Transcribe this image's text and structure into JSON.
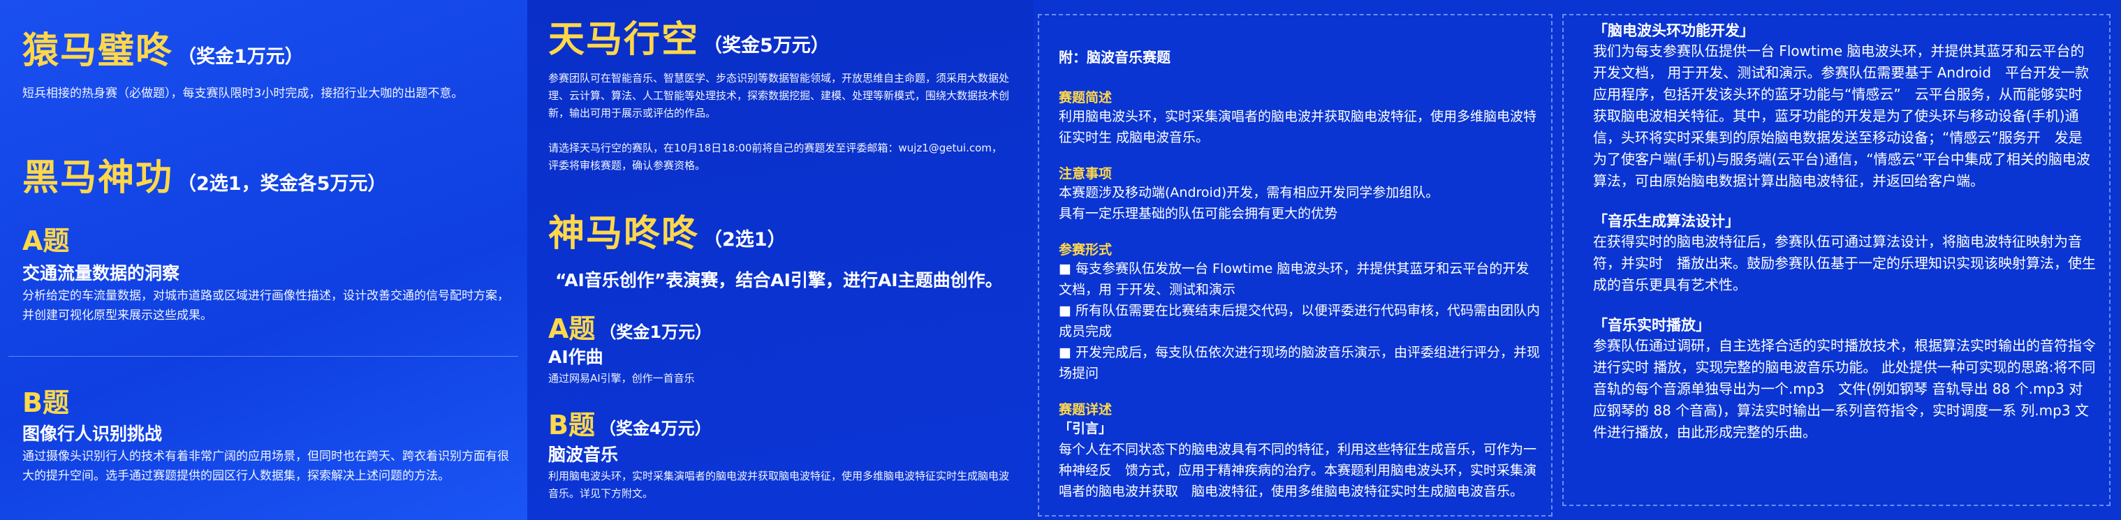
{
  "panel1": {
    "yuanma": {
      "title": "猿马璧咚",
      "sub": "（奖金1万元）",
      "desc": "短兵相接的热身赛（必做题），每支赛队限时3小时完成，接招行业大咖的出题不意。"
    },
    "heima": {
      "title": "黑马神功",
      "sub": "（2选1，奖金各5万元）"
    },
    "a": {
      "title": "A题",
      "name": "交通流量数据的洞察",
      "desc": "分析给定的车流量数据，对城市道路或区域进行画像性描述，设计改善交通的信号配时方案，并创建可视化原型来展示这些成果。"
    },
    "b": {
      "title": "B题",
      "name": "图像行人识别挑战",
      "desc": "通过摄像头识别行人的技术有着非常广阔的应用场景，但同时也在跨天、跨衣着识别方面有很大的提升空间。选手通过赛题提供的园区行人数据集，探索解决上述问题的方法。"
    }
  },
  "panel2": {
    "tianma": {
      "title": "天马行空",
      "sub": "（奖金5万元）",
      "desc": "参赛团队可在智能音乐、智慧医学、步态识别等数据智能领域，开放思维自主命题，须采用大数据处理、云计算、算法、人工智能等处理技术，探索数据挖掘、建模、处理等新模式，围绕大数据技术创新，输出可用于展示或评估的作品。",
      "note": "请选择天马行空的赛队，在10月18日18:00前将自己的赛题发至评委邮箱：wujz1@getui.com，评委将审核赛题，确认参赛资格。"
    },
    "shenma": {
      "title": "神马咚咚",
      "sub": "（2选1）",
      "tagline": "“AI音乐创作”表演赛，结合AI引擎，进行AI主题曲创作。"
    },
    "a": {
      "title": "A题",
      "sub": "（奖金1万元）",
      "name": "AI作曲",
      "desc": "通过网易AI引擎，创作一首音乐"
    },
    "b": {
      "title": "B题",
      "sub": "（奖金4万元）",
      "name": "脑波音乐",
      "desc": "利用脑电波头环，实时采集演唱者的脑电波并获取脑电波特征，使用多维脑电波特征实时生成脑电波音乐。详见下方附文。"
    }
  },
  "panel3": {
    "appendix": "附：脑波音乐赛题",
    "intro_head": "赛题简述",
    "intro_body": "利用脑电波头环，实时采集演唱者的脑电波并获取脑电波特征，使用多维脑电波特征实时生 成脑电波音乐。",
    "notes_head": "注意事项",
    "notes_1": "本赛题涉及移动端(Android)开发，需有相应开发同学参加组队。",
    "notes_2": "具有一定乐理基础的队伍可能会拥有更大的优势",
    "form_head": "参赛形式",
    "form_1": "■ 每支参赛队伍发放一台 Flowtime 脑电波头环，并提供其蓝牙和云平台的开发文档，用 于开发、测试和演示",
    "form_2": "■ 所有队伍需要在比赛结束后提交代码，以便评委进行代码审核，代码需由团队内成员完成",
    "form_3": "■ 开发完成后，每支队伍依次进行现场的脑波音乐演示，由评委组进行评分，并现场提问",
    "detail_head": "赛题详述",
    "preface_head": "「引言」",
    "preface_body": "每个人在不同状态下的脑电波具有不同的特征，利用这些特征生成音乐，可作为一种神经反　馈方式，应用于精神疾病的治疗。本赛题利用脑电波头环，实时采集演唱者的脑电波并获取　脑电波特征，使用多维脑电波特征实时生成脑电波音乐。"
  },
  "panel4": {
    "func_head": "「脑电波头环功能开发」",
    "func_body": "我们为每支参赛队伍提供一台 Flowtime 脑电波头环，并提供其蓝牙和云平台的开发文档， 用于开发、测试和演示。参赛队伍需要基于 Android　平台开发一款应用程序，包括开发该头环的蓝牙功能与“情感云”　云平台服务，从而能够实时获取脑电波相关特征。其中，蓝牙功能的开发是为了使头环与移动设备(手机)通信，头环将实时采集到的原始脑电数据发送至移动设备；“情感云”服务开　发是为了使客户端(手机)与服务端(云平台)通信，“情感云”平台中集成了相关的脑电波 算法，可由原始脑电数据计算出脑电波特征，并返回给客户端。",
    "algo_head": "「音乐生成算法设计」",
    "algo_body": "在获得实时的脑电波特征后，参赛队伍可通过算法设计，将脑电波特征映射为音符，并实时　播放出来。鼓励参赛队伍基于一定的乐理知识实现该映射算法，使生成的音乐更具有艺术性。",
    "play_head": "「音乐实时播放」",
    "play_body": "参赛队伍通过调研，自主选择合适的实时播放技术，根据算法实时输出的音符指令进行实时 播放，实现完整的脑电波音乐功能。 此处提供一种可实现的思路:将不同音轨的每个音源单独导出为一个.mp3　文件(例如钢琴 音轨导出 88 个.mp3 对应钢琴的 88 个音高)，算法实时输出一系列音符指令，实时调度一系 列.mp3 文件进行播放，由此形成完整的乐曲。"
  }
}
